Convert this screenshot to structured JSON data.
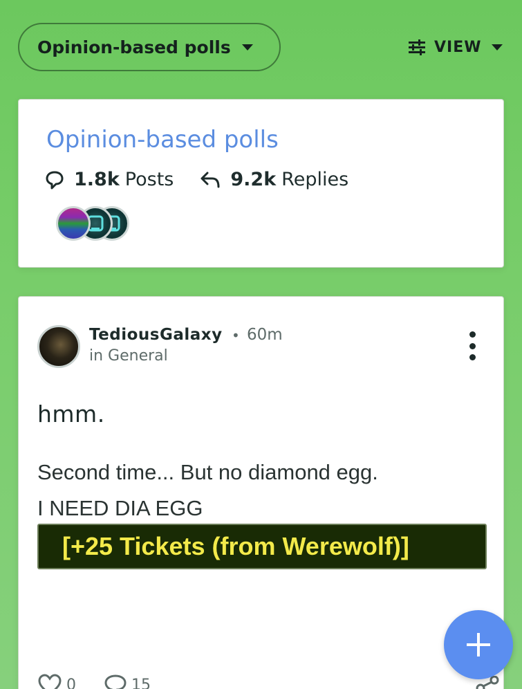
{
  "topbar": {
    "topic_selector": "Opinion-based polls",
    "view_label": "VIEW",
    "filter_icon": "sliders-icon"
  },
  "topic_card": {
    "title": "Opinion-based polls",
    "posts_count": "1.8k",
    "posts_label": "Posts",
    "replies_count": "9.2k",
    "replies_label": "Replies",
    "accent_color": "#5b8de0"
  },
  "post": {
    "author": "TediousGalaxy",
    "separator": "•",
    "time": "60m",
    "location": "in General",
    "title": "hmm.",
    "body_line_1": "Second time... But no diamond egg.",
    "body_line_2": "I NEED DIA EGG",
    "embed_text": "[+25 Tickets (from Werewolf)]",
    "likes": "0",
    "replies": "15"
  },
  "colors": {
    "background": "#6cc85e",
    "fab": "#5b8ef0",
    "embed_bg": "#192b05",
    "embed_text": "#f3ea4a"
  }
}
